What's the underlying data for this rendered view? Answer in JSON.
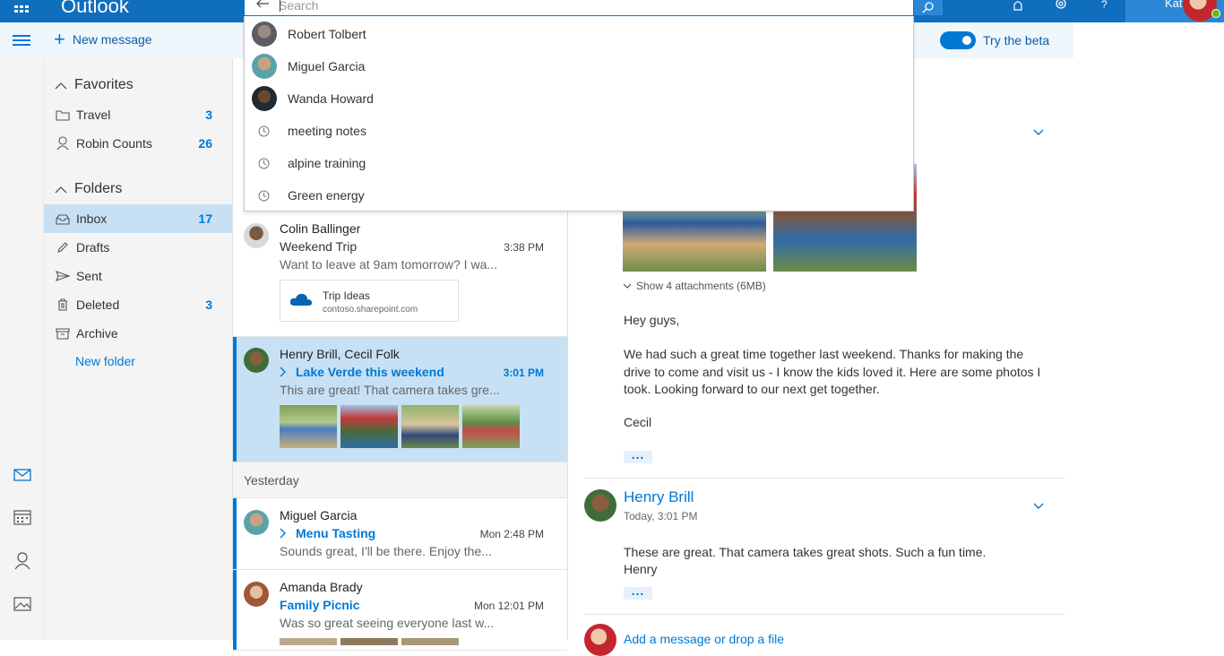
{
  "app": {
    "brand": "Outlook"
  },
  "header": {
    "user_name": "Kat"
  },
  "search": {
    "placeholder": "Search",
    "suggestions": [
      {
        "type": "person",
        "text": "Robert Tolbert"
      },
      {
        "type": "person",
        "text": "Miguel Garcia"
      },
      {
        "type": "person",
        "text": "Wanda Howard"
      },
      {
        "type": "history",
        "text": "meeting notes"
      },
      {
        "type": "history",
        "text": "alpine training"
      },
      {
        "type": "history",
        "text": "Green energy"
      }
    ]
  },
  "toolbar": {
    "new_message": "New message",
    "beta_label": "Try the beta"
  },
  "folders": {
    "favorites_label": "Favorites",
    "folders_label": "Folders",
    "favorites": [
      {
        "label": "Travel",
        "count": "3",
        "icon": "folder-icon"
      },
      {
        "label": "Robin Counts",
        "count": "26",
        "icon": "person-icon"
      }
    ],
    "items": [
      {
        "label": "Inbox",
        "count": "17",
        "icon": "inbox-icon",
        "selected": true
      },
      {
        "label": "Drafts",
        "count": "",
        "icon": "pencil-icon"
      },
      {
        "label": "Sent",
        "count": "",
        "icon": "send-icon"
      },
      {
        "label": "Deleted",
        "count": "3",
        "icon": "trash-icon"
      },
      {
        "label": "Archive",
        "count": "",
        "icon": "archive-icon"
      }
    ],
    "new_folder": "New folder"
  },
  "messages": [
    {
      "sender": "Colin Ballinger",
      "subject": "Weekend Trip",
      "time": "3:38 PM",
      "preview": "Want to leave at 9am tomorrow? I wa...",
      "attachment": {
        "title": "Trip Ideas",
        "url": "contoso.sharepoint.com"
      }
    },
    {
      "sender": "Henry Brill, Cecil Folk",
      "subject": "Lake Verde this weekend",
      "time": "3:01 PM",
      "preview": "This are great! That camera takes gre...",
      "selected": true
    },
    {
      "sender": "Miguel Garcia",
      "subject": "Menu Tasting",
      "time": "Mon 2:48 PM",
      "preview": "Sounds great, I'll be there. Enjoy the..."
    },
    {
      "sender": "Amanda Brady",
      "subject": "Family Picnic",
      "time": "Mon 12:01 PM",
      "preview": "Was so great seeing everyone last w..."
    }
  ],
  "group_yesterday": "Yesterday",
  "reading": {
    "show_attachments": "Show 4 attachments (6MB)",
    "greeting": "Hey guys,",
    "body": "We had such a great time together last weekend. Thanks for making the drive to come and visit us - I know the kids loved it. Here are some photos I took. Looking forward to our next get together.",
    "signature": "Cecil",
    "ellipsis": "...",
    "reply_sender": "Henry Brill",
    "reply_date": "Today, 3:01 PM",
    "reply_body": "These are great. That camera takes great shots. Such a fun time.",
    "reply_signature": "Henry",
    "add_message": "Add a message or drop a file"
  },
  "colors": {
    "brand_blue": "#106ebe",
    "accent": "#0078d4",
    "selected_bg": "#c7e0f4"
  }
}
